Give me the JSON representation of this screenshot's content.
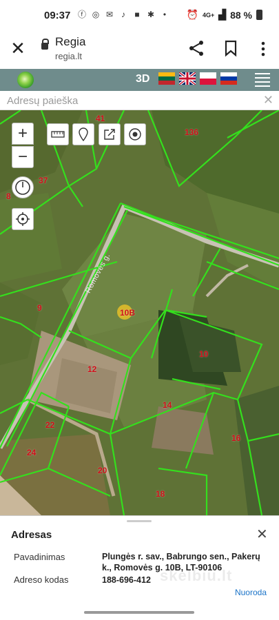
{
  "status_bar": {
    "time": "09:37",
    "network": "4G+",
    "battery": "88 %"
  },
  "browser": {
    "title": "Regia",
    "url": "regia.lt"
  },
  "site_header": {
    "mode_3d": "3D",
    "languages": [
      "lt",
      "en",
      "pl",
      "ru"
    ]
  },
  "search": {
    "placeholder": "Adresų paieška",
    "clear": "✕"
  },
  "map": {
    "street_label": "Romovės g.",
    "parcels": [
      "41",
      "136",
      "37",
      "8",
      "9",
      "10B",
      "10",
      "12",
      "14",
      "16",
      "22",
      "24",
      "20",
      "18"
    ],
    "controls": {
      "zoom_in": "+",
      "zoom_out": "−"
    }
  },
  "info_panel": {
    "title": "Adresas",
    "name_label": "Pavadinimas",
    "name_value": "Plungės r. sav., Babrungo sen., Pakerų k., Romovės g. 10B, LT-90106",
    "code_label": "Adreso kodas",
    "code_value": "188-696-412",
    "link": "Nuoroda",
    "watermark": "skelbiu.lt"
  }
}
